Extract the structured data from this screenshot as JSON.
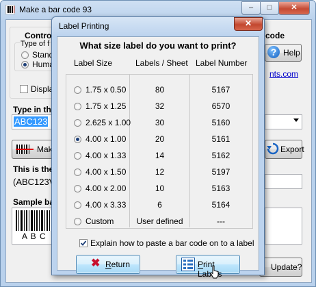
{
  "main_window": {
    "title": "Make a bar code 93",
    "controls": {
      "minimize": "–",
      "maximize": "□",
      "close": "✕"
    },
    "control_group_label": "Control",
    "type_group_label": "Type of f",
    "radio_standard": "Standa",
    "radio_human": "Huma",
    "display_checkbox": "Display",
    "type_in_label": "Type in the",
    "barcode_value": "ABC123",
    "make_button": "Make",
    "this_is_label": "This is the",
    "encoded_text": "(ABC123V",
    "sample_label": "Sample ba",
    "sample_chars": "A B C",
    "right_heading": "code",
    "help_button": "Help",
    "website_fragment": "nts.com",
    "export_button": "Export",
    "update_button": "Update?"
  },
  "dialog": {
    "title": "Label Printing",
    "close": "✕",
    "question": "What size label do you want to print?",
    "headers": {
      "size": "Label Size",
      "per_sheet": "Labels / Sheet",
      "number": "Label Number"
    },
    "rows": [
      {
        "size": "1.75 x 0.50",
        "per_sheet": "80",
        "number": "5167",
        "selected": false
      },
      {
        "size": "1.75 x 1.25",
        "per_sheet": "32",
        "number": "6570",
        "selected": false
      },
      {
        "size": "2.625 x 1.00",
        "per_sheet": "30",
        "number": "5160",
        "selected": false
      },
      {
        "size": "4.00 x 1.00",
        "per_sheet": "20",
        "number": "5161",
        "selected": true
      },
      {
        "size": "4.00 x 1.33",
        "per_sheet": "14",
        "number": "5162",
        "selected": false
      },
      {
        "size": "4.00 x 1.50",
        "per_sheet": "12",
        "number": "5197",
        "selected": false
      },
      {
        "size": "4.00 x 2.00",
        "per_sheet": "10",
        "number": "5163",
        "selected": false
      },
      {
        "size": "4.00 x 3.33",
        "per_sheet": "6",
        "number": "5164",
        "selected": false
      },
      {
        "size": "Custom",
        "per_sheet": "User defined",
        "number": "---",
        "selected": false
      }
    ],
    "explain_checkbox": "Explain how to paste a bar code on to a label",
    "explain_checked": true,
    "return_button": {
      "prefix": "R",
      "rest": "eturn"
    },
    "print_button": {
      "prefix": "P",
      "rest": "rint Labels"
    }
  }
}
